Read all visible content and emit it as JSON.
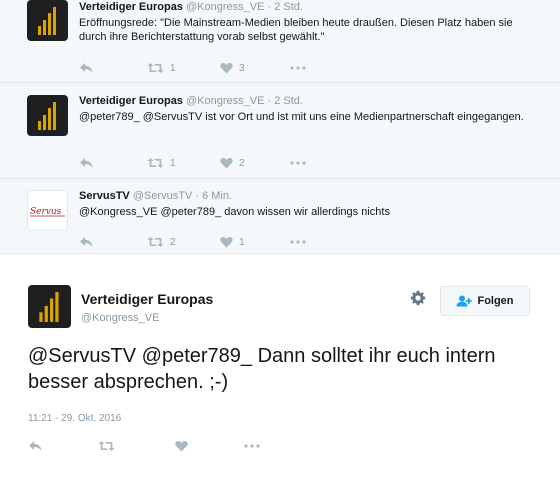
{
  "thread": [
    {
      "name": "Verteidiger Europas",
      "handle": "@Kongress_VE",
      "separator": "·",
      "time": "2 Std.",
      "text": "Eröffnungsrede: \"Die Mainstream-Medien bleiben heute draußen. Diesen Platz haben sie durch ihre Berichterstattung vorab selbst gewählt.\"",
      "retweets": "1",
      "likes": "3"
    },
    {
      "name": "Verteidiger Europas",
      "handle": "@Kongress_VE",
      "separator": "·",
      "time": "2 Std.",
      "text": "@peter789_ @ServusTV ist vor Ort und ist mit uns eine Medienpartnerschaft eingegangen.",
      "retweets": "1",
      "likes": "2"
    },
    {
      "name": "ServusTV",
      "handle": "@ServusTV",
      "separator": "·",
      "time": "6 Min.",
      "text": "@Kongress_VE @peter789_ davon wissen wir allerdings nichts",
      "retweets": "2",
      "likes": "1",
      "avatar_text": "Servus"
    }
  ],
  "main": {
    "name": "Verteidiger Europas",
    "handle": "@Kongress_VE",
    "follow_label": "Folgen",
    "text": "@ServusTV @peter789_ Dann solltet ihr euch intern besser absprechen. ;-)",
    "timestamp": "11:21 - 29. Okt. 2016"
  },
  "colors": {
    "gold": "#d9a400",
    "link_blue": "#1da1f2",
    "muted": "#8899a6",
    "icon": "#aab8c2"
  }
}
